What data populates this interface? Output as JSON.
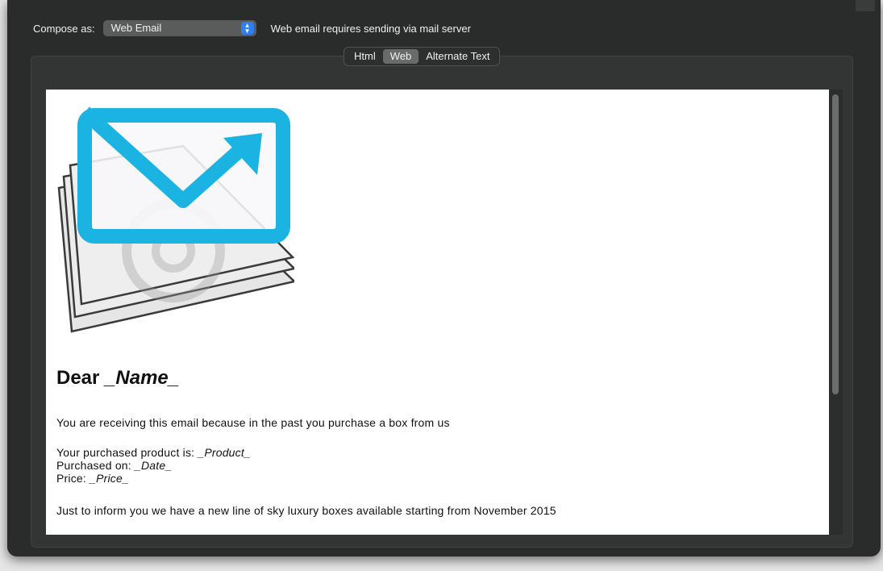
{
  "compose": {
    "label": "Compose as:",
    "selected": "Web Email",
    "arrows_up": "▲",
    "arrows_down": "▼",
    "note": "Web email requires sending via mail server"
  },
  "tabs": [
    {
      "label": "Html",
      "selected": false
    },
    {
      "label": "Web",
      "selected": true
    },
    {
      "label": "Alternate Text",
      "selected": false
    }
  ],
  "email": {
    "greeting_prefix": "Dear ",
    "greeting_name": "_Name_",
    "intro": "You are receiving this email because in the past you purchase a box from us",
    "product_label": "Your purchased product is: ",
    "product_value": "_Product_",
    "date_label": "Purchased on: ",
    "date_value": "_Date_",
    "price_label": "Price: ",
    "price_value": "_Price_",
    "announcement": "Just to inform you we have a new line of sky luxury boxes available starting from November 2015"
  },
  "colors": {
    "window_bg": "#2a2b2b",
    "accent_blue": "#2f7ef4",
    "logo_cyan": "#1ab3e2",
    "content_bg": "#ffffff"
  },
  "icons": {
    "select_arrows": "updown-chevron-icon",
    "logo": "mail-send-logo-icon",
    "at_symbol": "at-sign-icon"
  }
}
